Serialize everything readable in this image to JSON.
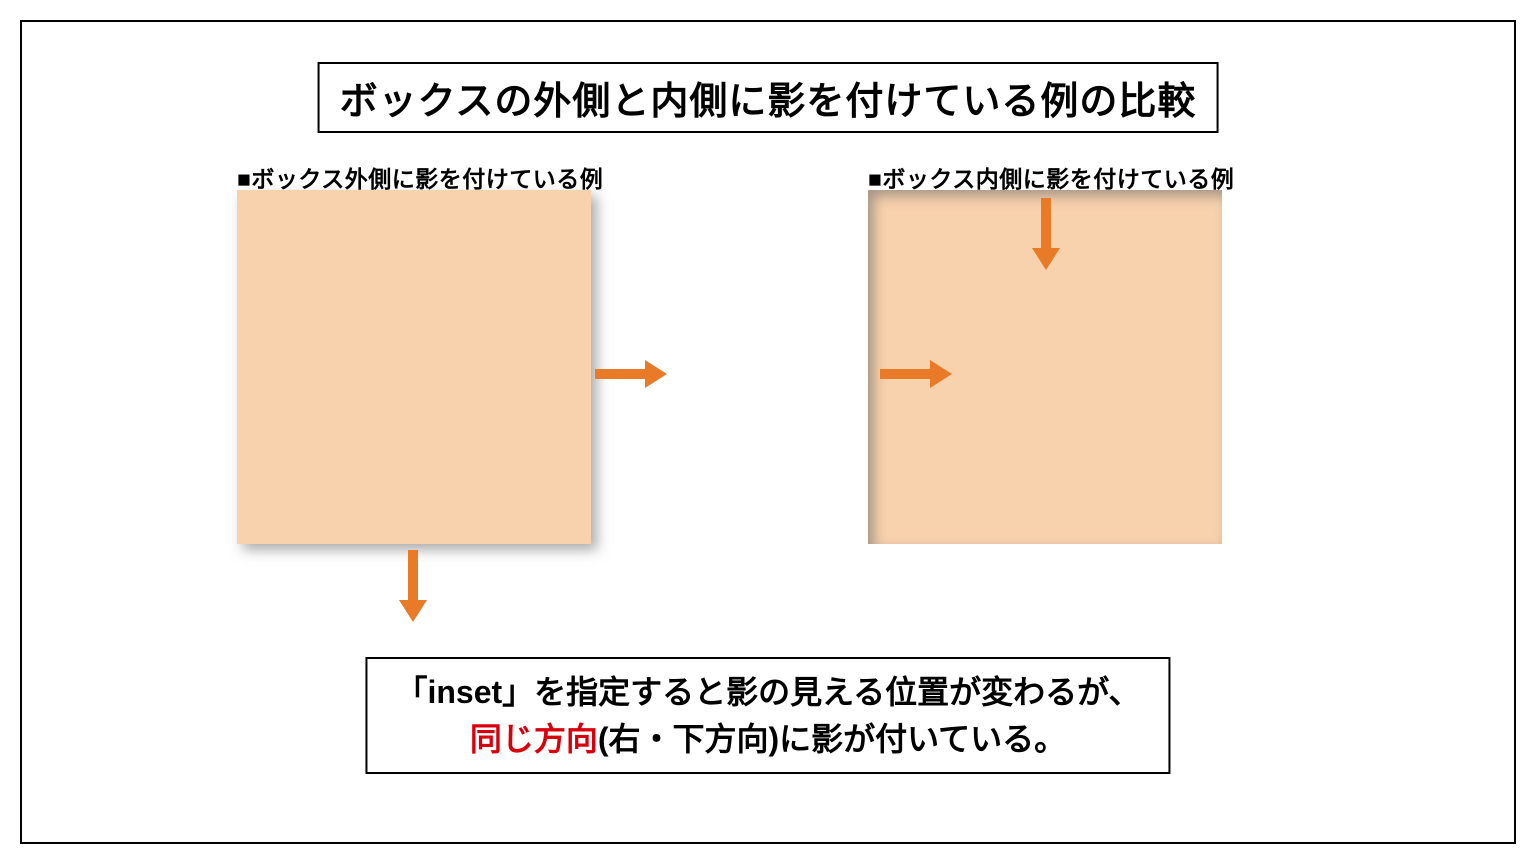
{
  "title": "ボックスの外側と内側に影を付けている例の比較",
  "left": {
    "caption": "■ボックス外側に影を付けている例"
  },
  "right": {
    "caption": "■ボックス内側に影を付けている例"
  },
  "footer": {
    "line1": "「inset」を指定すると影の見える位置が変わるが、",
    "red": "同じ方向",
    "line2tail": "(右・下方向)に影が付いている。"
  },
  "colors": {
    "box_fill": "#f8d1ad",
    "arrow": "#e87a28",
    "emphasis": "#d9000d"
  }
}
